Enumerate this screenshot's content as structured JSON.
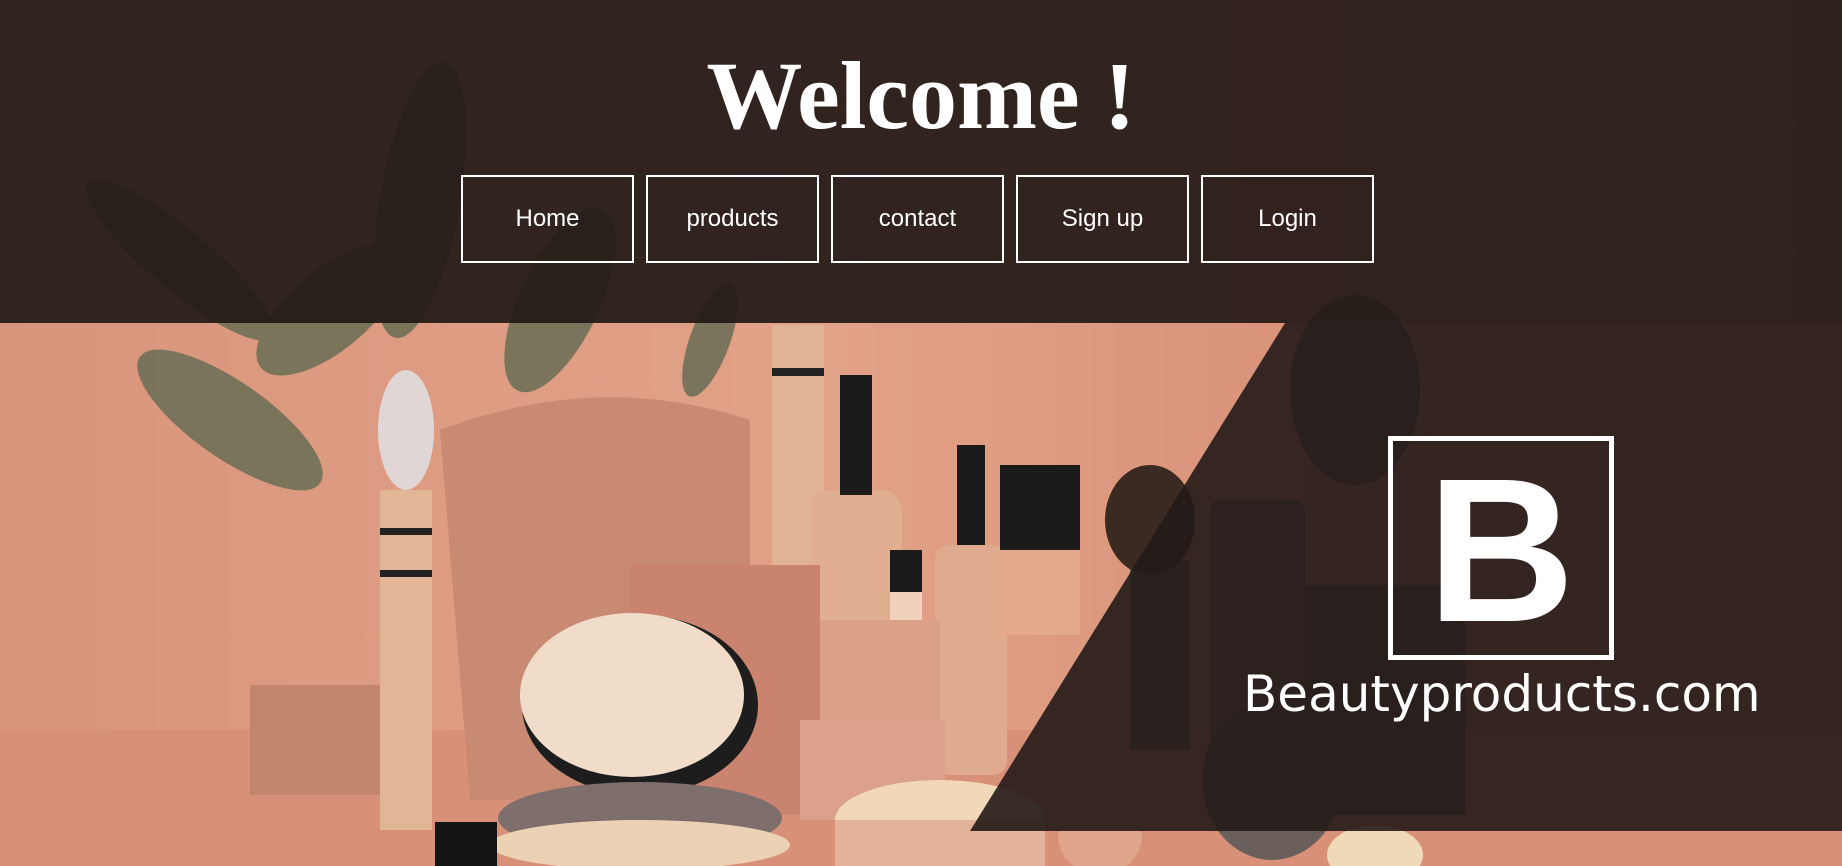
{
  "header": {
    "title": "Welcome !"
  },
  "nav": {
    "items": [
      {
        "label": "Home"
      },
      {
        "label": "products"
      },
      {
        "label": "contact"
      },
      {
        "label": "Sign up"
      },
      {
        "label": "Login"
      }
    ]
  },
  "brand": {
    "logo_letter": "B",
    "site_name": "Beautyproducts.com"
  },
  "colors": {
    "dark_overlay": "#241a17",
    "background_peach": "#e2a288",
    "text": "#ffffff"
  }
}
